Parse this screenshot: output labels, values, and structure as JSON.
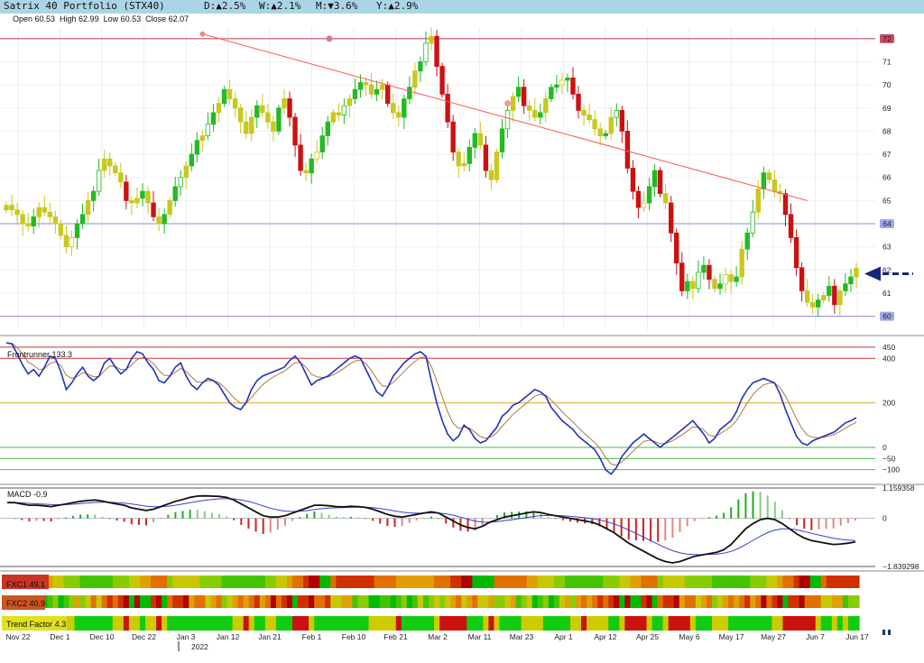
{
  "header": {
    "title": "Satrix 40 Portfolio (STX40)",
    "day": "D:▲2.5%",
    "week": "W:▲2.1%",
    "month": "M:▼3.6%",
    "year": "Y:▲2.9%",
    "ohlc": "Open 60.53  High 62.99  Low 60.53  Close 62.07"
  },
  "colors": {
    "up_bar": "#22bb22",
    "up_hollow": "#cccc22",
    "down_bar": "#cc1111",
    "yellow_bar": "#c8c81e",
    "trendline": "#ff5555",
    "level_line": "#8888ee",
    "frontrunner_line": "#2233bb",
    "frontrunner_signal": "#a87a44",
    "macd_line": "#111111",
    "macd_signal": "#3344cc",
    "arrow": "#1a237e"
  },
  "chart_data": [
    {
      "type": "candlestick",
      "title": "Satrix 40 Portfolio (STX40)",
      "ylim": [
        59.4,
        72.5
      ],
      "y_ticks": [
        "60",
        "61",
        "62",
        "63",
        "64",
        "65",
        "66",
        "67",
        "68",
        "69",
        "70",
        "71",
        "72"
      ],
      "x_labels": [
        "Nov 22",
        "Dec 1",
        "Dec 10",
        "Dec 22",
        "Jan 3",
        "Jan 12",
        "Jan 21",
        "Feb 1",
        "Feb 10",
        "Feb 21",
        "Mar 2",
        "Mar 11",
        "Mar 23",
        "Apr 1",
        "Apr 12",
        "Apr 25",
        "May 6",
        "May 17",
        "May 27",
        "Jun 7",
        "Jun 17"
      ],
      "year_label": "2022",
      "highlighted_levels": [
        "72",
        "64",
        "60"
      ],
      "level_values": [
        72,
        64,
        60
      ],
      "trendline": {
        "from": [
          36,
          72.2
        ],
        "to": [
          147,
          65.0
        ]
      },
      "close_series": [
        64.8,
        64.6,
        64.4,
        64.0,
        63.9,
        64.3,
        64.7,
        64.5,
        64.3,
        64.0,
        63.5,
        63.0,
        63.4,
        64.0,
        64.4,
        65.0,
        65.4,
        66.3,
        66.8,
        66.5,
        66.2,
        65.8,
        65.0,
        64.9,
        65.1,
        65.4,
        64.9,
        64.3,
        64.0,
        64.4,
        65.0,
        65.6,
        66.0,
        66.5,
        67.0,
        67.6,
        67.8,
        68.3,
        68.8,
        69.2,
        69.8,
        69.4,
        69.0,
        68.4,
        67.9,
        68.6,
        69.1,
        68.8,
        68.4,
        68.0,
        69.0,
        69.4,
        68.6,
        67.4,
        66.3,
        66.2,
        66.8,
        67.1,
        67.8,
        68.4,
        68.8,
        68.7,
        69.1,
        69.4,
        69.8,
        70.1,
        70.0,
        69.6,
        69.8,
        70.0,
        69.2,
        68.8,
        68.6,
        69.4,
        69.9,
        70.6,
        71.0,
        71.8,
        72.1,
        70.8,
        69.6,
        68.4,
        67.1,
        66.5,
        66.6,
        67.3,
        67.9,
        67.4,
        66.3,
        65.9,
        67.1,
        68.1,
        68.9,
        69.5,
        69.9,
        69.1,
        68.9,
        68.6,
        68.8,
        69.4,
        69.9,
        70.0,
        70.2,
        70.3,
        69.6,
        68.9,
        68.7,
        68.5,
        68.1,
        67.8,
        67.9,
        68.6,
        68.9,
        68.0,
        66.4,
        65.4,
        64.7,
        64.9,
        65.6,
        66.3,
        65.3,
        64.9,
        63.6,
        62.3,
        61.1,
        61.5,
        61.2,
        61.9,
        62.2,
        61.6,
        61.2,
        61.4,
        61.8,
        61.5,
        61.7,
        62.9,
        63.6,
        64.5,
        65.5,
        66.2,
        65.9,
        65.4,
        65.3,
        64.4,
        63.4,
        62.1,
        61.1,
        60.6,
        60.4,
        60.7,
        60.9,
        61.3,
        60.5,
        61.1,
        61.4,
        61.7,
        62.07
      ],
      "current_close": 62.07
    },
    {
      "type": "line",
      "title": "Frontrunner 133.3",
      "ylim": [
        -150,
        470
      ],
      "y_ticks": [
        "450",
        "400",
        "200",
        "0",
        "-50",
        "-100"
      ],
      "reference_levels": [
        450,
        400,
        200,
        0,
        -50,
        -100
      ],
      "series": [
        {
          "name": "Frontrunner 133.3",
          "values": [
            470,
            465,
            420,
            370,
            330,
            350,
            320,
            360,
            410,
            400,
            340,
            260,
            290,
            330,
            360,
            320,
            300,
            320,
            380,
            400,
            360,
            330,
            350,
            400,
            430,
            420,
            380,
            350,
            300,
            290,
            320,
            360,
            380,
            320,
            280,
            260,
            290,
            310,
            300,
            280,
            240,
            200,
            180,
            170,
            200,
            260,
            300,
            320,
            330,
            340,
            350,
            360,
            390,
            410,
            380,
            330,
            280,
            300,
            310,
            320,
            340,
            360,
            380,
            400,
            410,
            400,
            350,
            300,
            250,
            230,
            270,
            320,
            350,
            380,
            400,
            420,
            430,
            410,
            300,
            200,
            120,
            60,
            30,
            50,
            100,
            80,
            40,
            20,
            30,
            60,
            90,
            140,
            160,
            190,
            200,
            220,
            240,
            260,
            250,
            230,
            180,
            150,
            120,
            100,
            80,
            50,
            30,
            10,
            -10,
            -50,
            -100,
            -120,
            -90,
            -40,
            -10,
            20,
            40,
            60,
            40,
            20,
            0,
            20,
            40,
            60,
            80,
            100,
            120,
            90,
            60,
            20,
            40,
            80,
            100,
            120,
            160,
            220,
            260,
            290,
            300,
            310,
            300,
            290,
            240,
            170,
            110,
            50,
            20,
            10,
            30,
            40,
            50,
            60,
            70,
            90,
            110,
            120,
            133.3
          ]
        },
        {
          "name": "signal",
          "values": []
        }
      ]
    },
    {
      "type": "bar+line",
      "title": "MACD -0.9",
      "ylim": [
        -1.839298,
        1.159358
      ],
      "y_ticks": [
        "1.159358",
        "0",
        "-1.839298"
      ],
      "series": [
        {
          "name": "MACD -0.9",
          "values": [
            0.6,
            0.6,
            0.55,
            0.5,
            0.5,
            0.48,
            0.45,
            0.5,
            0.55,
            0.6,
            0.65,
            0.68,
            0.7,
            0.66,
            0.6,
            0.55,
            0.5,
            0.4,
            0.35,
            0.3,
            0.35,
            0.45,
            0.55,
            0.65,
            0.72,
            0.8,
            0.85,
            0.86,
            0.85,
            0.84,
            0.8,
            0.7,
            0.55,
            0.4,
            0.25,
            0.1,
            0.05,
            0.05,
            0.1,
            0.2,
            0.3,
            0.4,
            0.5,
            0.5,
            0.48,
            0.45,
            0.44,
            0.46,
            0.45,
            0.42,
            0.35,
            0.25,
            0.15,
            0.08,
            0.05,
            0.1,
            0.15,
            0.2,
            0.25,
            0.2,
            0.05,
            -0.1,
            -0.25,
            -0.35,
            -0.4,
            -0.3,
            -0.15,
            -0.05,
            0.05,
            0.1,
            0.15,
            0.2,
            0.25,
            0.22,
            0.15,
            0.1,
            0.05,
            0.0,
            -0.05,
            -0.1,
            -0.15,
            -0.25,
            -0.4,
            -0.55,
            -0.75,
            -0.95,
            -1.1,
            -1.25,
            -1.4,
            -1.55,
            -1.65,
            -1.7,
            -1.65,
            -1.55,
            -1.45,
            -1.4,
            -1.35,
            -1.3,
            -1.2,
            -1.0,
            -0.7,
            -0.4,
            -0.2,
            -0.05,
            0.0,
            -0.05,
            -0.2,
            -0.4,
            -0.6,
            -0.75,
            -0.85,
            -0.9,
            -0.95,
            -1.0,
            -0.98,
            -0.95,
            -0.9
          ]
        },
        {
          "name": "signal",
          "values": []
        },
        {
          "name": "histogram",
          "values": []
        }
      ]
    },
    {
      "type": "heatmap",
      "title": "FXC1 49.1",
      "ylim": [
        0,
        1
      ]
    },
    {
      "type": "heatmap",
      "title": "FXC2 40.9",
      "ylim": [
        0,
        1
      ]
    },
    {
      "type": "heatmap",
      "title": "Trend Factor 4.3",
      "ylim": [
        0,
        1
      ]
    }
  ]
}
